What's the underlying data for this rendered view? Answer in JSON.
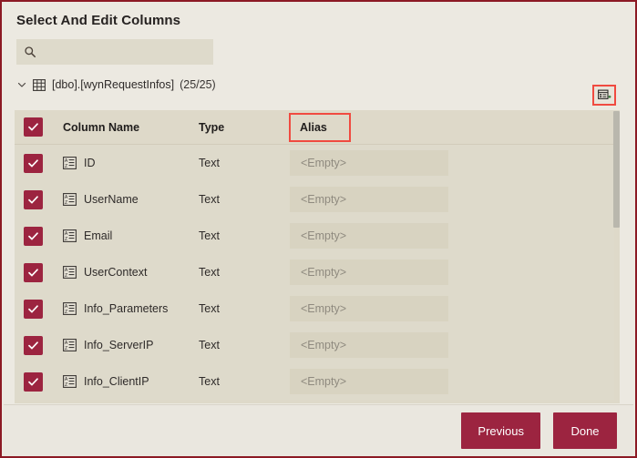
{
  "dialog": {
    "title": "Select And Edit Columns"
  },
  "search": {
    "placeholder": "",
    "value": "",
    "icon": "search-icon"
  },
  "tree": {
    "expanded": true,
    "chevron_icon": "chevron-down-icon",
    "table_icon": "table-icon",
    "label": "[dbo].[wynRequestInfos]",
    "count": "(25/25)"
  },
  "toolbar": {
    "add_alias_icon": "add-alias-icon",
    "add_alias_highlight_color": "#f04a40"
  },
  "grid": {
    "headers": {
      "select_all_checked": true,
      "column_name": "Column Name",
      "type": "Type",
      "alias": "Alias"
    },
    "alias_highlight_color": "#f04a40",
    "alias_placeholder": "<Empty>",
    "rows": [
      {
        "checked": true,
        "icon": "text-type-icon",
        "name": "ID",
        "type": "Text",
        "alias": ""
      },
      {
        "checked": true,
        "icon": "text-type-icon",
        "name": "UserName",
        "type": "Text",
        "alias": ""
      },
      {
        "checked": true,
        "icon": "text-type-icon",
        "name": "Email",
        "type": "Text",
        "alias": ""
      },
      {
        "checked": true,
        "icon": "text-type-icon",
        "name": "UserContext",
        "type": "Text",
        "alias": ""
      },
      {
        "checked": true,
        "icon": "text-type-icon",
        "name": "Info_Parameters",
        "type": "Text",
        "alias": ""
      },
      {
        "checked": true,
        "icon": "text-type-icon",
        "name": "Info_ServerIP",
        "type": "Text",
        "alias": ""
      },
      {
        "checked": true,
        "icon": "text-type-icon",
        "name": "Info_ClientIP",
        "type": "Text",
        "alias": ""
      }
    ]
  },
  "footer": {
    "previous_label": "Previous",
    "done_label": "Done"
  },
  "colors": {
    "accent": "#9c2440",
    "page_border": "#8c1a24",
    "highlight": "#f04a40",
    "background": "#ece9e1",
    "row_background": "#dedacb"
  }
}
